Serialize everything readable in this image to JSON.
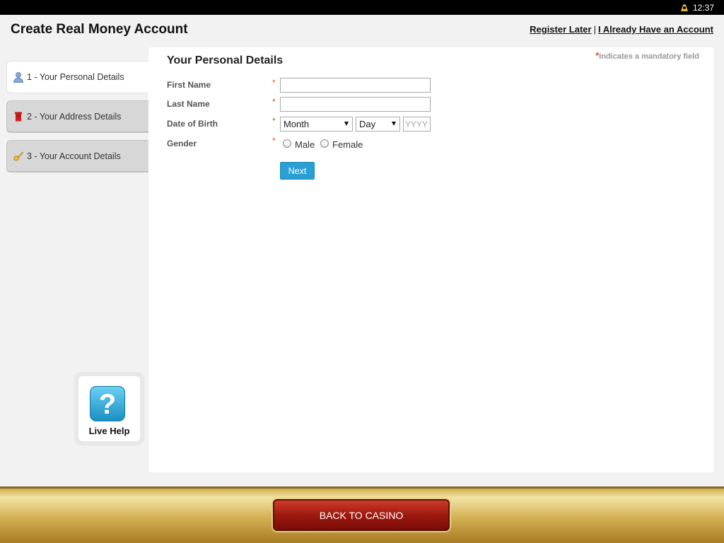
{
  "status_bar": {
    "time": "12:37"
  },
  "header": {
    "title": "Create Real Money Account",
    "register_later": "Register Later",
    "separator": "|",
    "have_account": "I Already Have an Account"
  },
  "steps": [
    {
      "label": "1 - Your Personal Details",
      "icon": "person-icon",
      "active": true
    },
    {
      "label": "2 - Your Address Details",
      "icon": "postbox-icon",
      "active": false
    },
    {
      "label": "3 - Your Account Details",
      "icon": "key-icon",
      "active": false
    }
  ],
  "form": {
    "title": "Your Personal Details",
    "mandatory_star": "*",
    "mandatory_note": "Indicates a mandatory field",
    "required_marker": "*",
    "first_name": {
      "label": "First Name",
      "value": ""
    },
    "last_name": {
      "label": "Last Name",
      "value": ""
    },
    "dob": {
      "label": "Date of Birth",
      "month": "Month",
      "day": "Day",
      "year_placeholder": "YYYY"
    },
    "gender": {
      "label": "Gender",
      "male": "Male",
      "female": "Female",
      "selected": ""
    },
    "next": "Next"
  },
  "live_help": {
    "icon_glyph": "?",
    "label": "Live Help"
  },
  "footer": {
    "back_button": "BACK TO CASINO"
  },
  "colors": {
    "accent": "#2a9fd6",
    "required": "#e0502a",
    "footer_gold": "#d4b055",
    "back_button_red": "#9e1a10"
  }
}
